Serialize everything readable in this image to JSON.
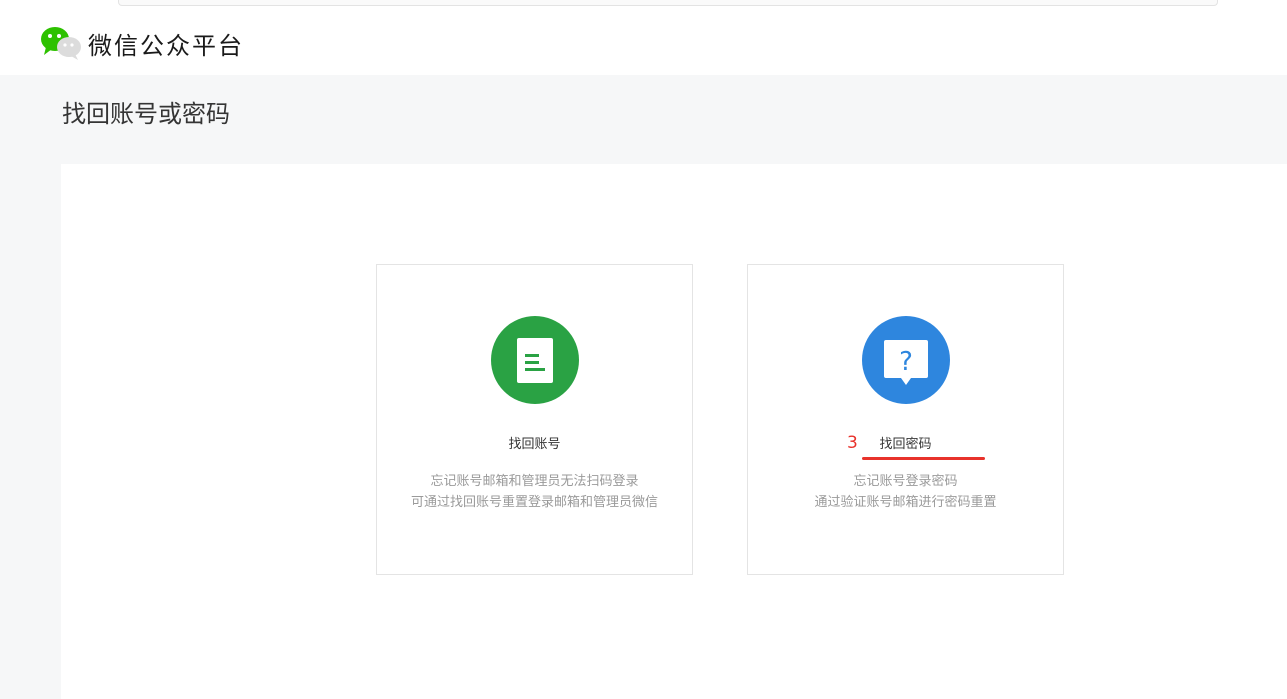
{
  "header": {
    "brand_name": "微信公众平台",
    "logo_icon": "wechat-logo-icon"
  },
  "page": {
    "title": "找回账号或密码"
  },
  "cards": [
    {
      "title": "找回账号",
      "icon": "document-icon",
      "color": "#2aa244",
      "desc_line1": "忘记账号邮箱和管理员无法扫码登录",
      "desc_line2": "可通过找回账号重置登录邮箱和管理员微信"
    },
    {
      "title": "找回密码",
      "icon": "question-bubble-icon",
      "color": "#2e86de",
      "desc_line1": "忘记账号登录密码",
      "desc_line2": "通过验证账号邮箱进行密码重置"
    }
  ],
  "annotation": {
    "number": "3",
    "color": "#e8322b"
  }
}
